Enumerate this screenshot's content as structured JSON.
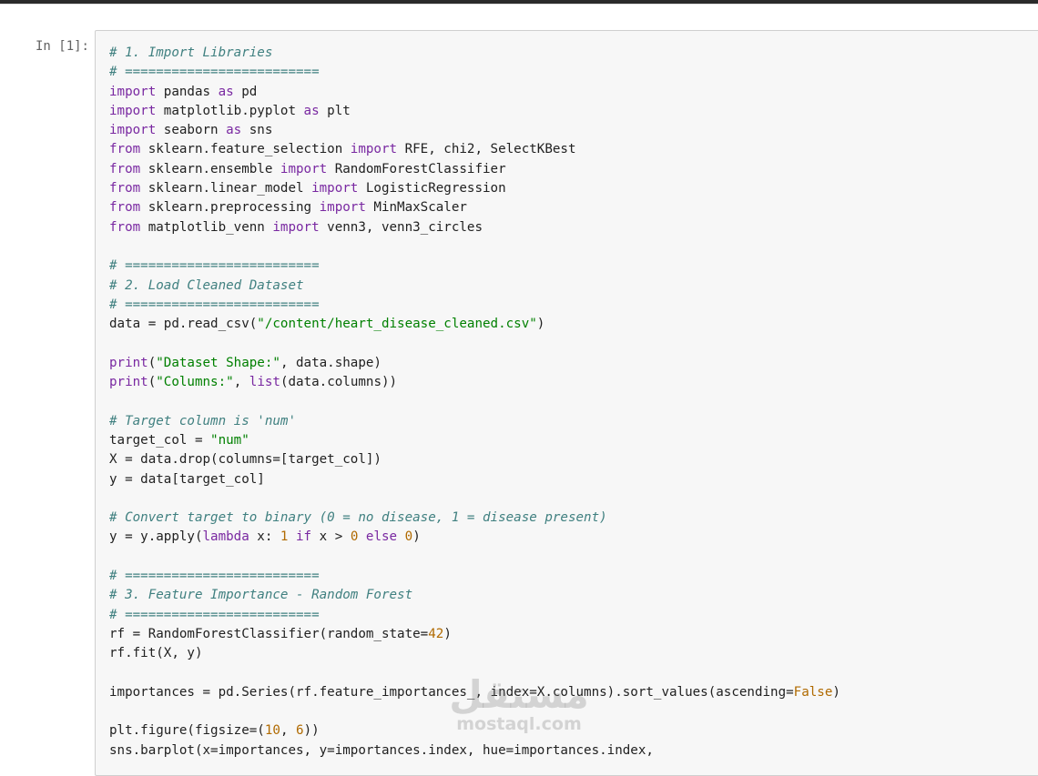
{
  "cell": {
    "prompt": "In [1]:",
    "lines": [
      [
        {
          "t": "# 1. Import Libraries",
          "c": "c"
        }
      ],
      [
        {
          "t": "# =========================",
          "c": "c"
        }
      ],
      [
        {
          "t": "import",
          "c": "k"
        },
        {
          "t": " pandas "
        },
        {
          "t": "as",
          "c": "k"
        },
        {
          "t": " pd"
        }
      ],
      [
        {
          "t": "import",
          "c": "k"
        },
        {
          "t": " matplotlib.pyplot "
        },
        {
          "t": "as",
          "c": "k"
        },
        {
          "t": " plt"
        }
      ],
      [
        {
          "t": "import",
          "c": "k"
        },
        {
          "t": " seaborn "
        },
        {
          "t": "as",
          "c": "k"
        },
        {
          "t": " sns"
        }
      ],
      [
        {
          "t": "from",
          "c": "k"
        },
        {
          "t": " sklearn.feature_selection "
        },
        {
          "t": "import",
          "c": "k"
        },
        {
          "t": " RFE, chi2, SelectKBest"
        }
      ],
      [
        {
          "t": "from",
          "c": "k"
        },
        {
          "t": " sklearn.ensemble "
        },
        {
          "t": "import",
          "c": "k"
        },
        {
          "t": " RandomForestClassifier"
        }
      ],
      [
        {
          "t": "from",
          "c": "k"
        },
        {
          "t": " sklearn.linear_model "
        },
        {
          "t": "import",
          "c": "k"
        },
        {
          "t": " LogisticRegression"
        }
      ],
      [
        {
          "t": "from",
          "c": "k"
        },
        {
          "t": " sklearn.preprocessing "
        },
        {
          "t": "import",
          "c": "k"
        },
        {
          "t": " MinMaxScaler"
        }
      ],
      [
        {
          "t": "from",
          "c": "k"
        },
        {
          "t": " matplotlib_venn "
        },
        {
          "t": "import",
          "c": "k"
        },
        {
          "t": " venn3, venn3_circles"
        }
      ],
      [],
      [
        {
          "t": "# =========================",
          "c": "c"
        }
      ],
      [
        {
          "t": "# 2. Load Cleaned Dataset",
          "c": "c"
        }
      ],
      [
        {
          "t": "# =========================",
          "c": "c"
        }
      ],
      [
        {
          "t": "data = pd.read_csv("
        },
        {
          "t": "\"/content/heart_disease_cleaned.csv\"",
          "c": "s"
        },
        {
          "t": ")"
        }
      ],
      [],
      [
        {
          "t": "print",
          "c": "b"
        },
        {
          "t": "("
        },
        {
          "t": "\"Dataset Shape:\"",
          "c": "s"
        },
        {
          "t": ", data.shape)"
        }
      ],
      [
        {
          "t": "print",
          "c": "b"
        },
        {
          "t": "("
        },
        {
          "t": "\"Columns:\"",
          "c": "s"
        },
        {
          "t": ", "
        },
        {
          "t": "list",
          "c": "b"
        },
        {
          "t": "(data.columns))"
        }
      ],
      [],
      [
        {
          "t": "# Target column is 'num'",
          "c": "c"
        }
      ],
      [
        {
          "t": "target_col = "
        },
        {
          "t": "\"num\"",
          "c": "s"
        }
      ],
      [
        {
          "t": "X = data.drop(columns=[target_col])"
        }
      ],
      [
        {
          "t": "y = data[target_col]"
        }
      ],
      [],
      [
        {
          "t": "# Convert target to binary (0 = no disease, 1 = disease present)",
          "c": "c"
        }
      ],
      [
        {
          "t": "y = y.apply("
        },
        {
          "t": "lambda",
          "c": "k"
        },
        {
          "t": " x: "
        },
        {
          "t": "1",
          "c": "m"
        },
        {
          "t": " "
        },
        {
          "t": "if",
          "c": "k"
        },
        {
          "t": " x > "
        },
        {
          "t": "0",
          "c": "m"
        },
        {
          "t": " "
        },
        {
          "t": "else",
          "c": "k"
        },
        {
          "t": " "
        },
        {
          "t": "0",
          "c": "m"
        },
        {
          "t": ")"
        }
      ],
      [],
      [
        {
          "t": "# =========================",
          "c": "c"
        }
      ],
      [
        {
          "t": "# 3. Feature Importance - Random Forest",
          "c": "c"
        }
      ],
      [
        {
          "t": "# =========================",
          "c": "c"
        }
      ],
      [
        {
          "t": "rf = RandomForestClassifier(random_state="
        },
        {
          "t": "42",
          "c": "m"
        },
        {
          "t": ")"
        }
      ],
      [
        {
          "t": "rf.fit(X, y)"
        }
      ],
      [],
      [
        {
          "t": "importances = pd.Series(rf.feature_importances_, index=X.columns).sort_values(ascending="
        },
        {
          "t": "False",
          "c": "m"
        },
        {
          "t": ")"
        }
      ],
      [],
      [
        {
          "t": "plt.figure(figsize=("
        },
        {
          "t": "10",
          "c": "m"
        },
        {
          "t": ", "
        },
        {
          "t": "6",
          "c": "m"
        },
        {
          "t": "))"
        }
      ],
      [
        {
          "t": "sns.barplot(x=importances, y=importances.index, hue=importances.index,"
        }
      ]
    ]
  },
  "watermark": {
    "arabic": "مستقل",
    "latin": "mostaql.com"
  }
}
